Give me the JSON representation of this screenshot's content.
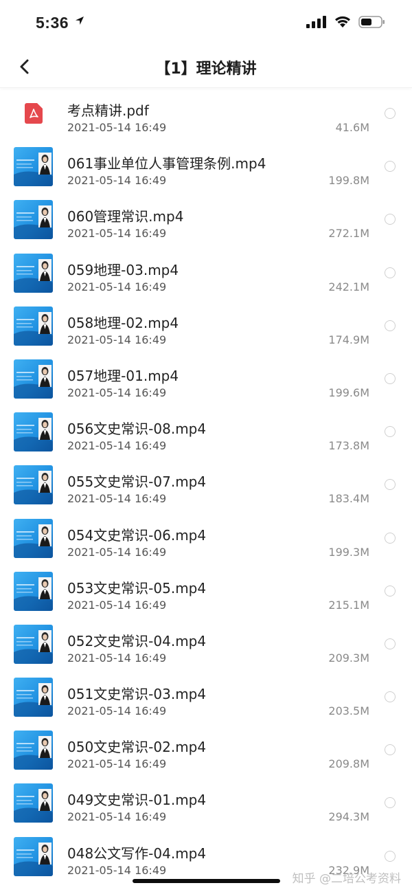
{
  "status_bar": {
    "time": "5:36"
  },
  "nav": {
    "title": "【1】理论精讲"
  },
  "files": [
    {
      "name": "考点精讲.pdf",
      "date": "2021-05-14 16:49",
      "size": "41.6M",
      "type": "pdf"
    },
    {
      "name": "061事业单位人事管理条例.mp4",
      "date": "2021-05-14 16:49",
      "size": "199.8M",
      "type": "video"
    },
    {
      "name": "060管理常识.mp4",
      "date": "2021-05-14 16:49",
      "size": "272.1M",
      "type": "video"
    },
    {
      "name": "059地理-03.mp4",
      "date": "2021-05-14 16:49",
      "size": "242.1M",
      "type": "video"
    },
    {
      "name": "058地理-02.mp4",
      "date": "2021-05-14 16:49",
      "size": "174.9M",
      "type": "video"
    },
    {
      "name": "057地理-01.mp4",
      "date": "2021-05-14 16:49",
      "size": "199.6M",
      "type": "video"
    },
    {
      "name": "056文史常识-08.mp4",
      "date": "2021-05-14 16:49",
      "size": "173.8M",
      "type": "video"
    },
    {
      "name": "055文史常识-07.mp4",
      "date": "2021-05-14 16:49",
      "size": "183.4M",
      "type": "video"
    },
    {
      "name": "054文史常识-06.mp4",
      "date": "2021-05-14 16:49",
      "size": "199.3M",
      "type": "video"
    },
    {
      "name": "053文史常识-05.mp4",
      "date": "2021-05-14 16:49",
      "size": "215.1M",
      "type": "video"
    },
    {
      "name": "052文史常识-04.mp4",
      "date": "2021-05-14 16:49",
      "size": "209.3M",
      "type": "video"
    },
    {
      "name": "051文史常识-03.mp4",
      "date": "2021-05-14 16:49",
      "size": "203.5M",
      "type": "video"
    },
    {
      "name": "050文史常识-02.mp4",
      "date": "2021-05-14 16:49",
      "size": "209.8M",
      "type": "video"
    },
    {
      "name": "049文史常识-01.mp4",
      "date": "2021-05-14 16:49",
      "size": "294.3M",
      "type": "video"
    },
    {
      "name": "048公文写作-04.mp4",
      "date": "2021-05-14 16:49",
      "size": "232.9M",
      "type": "video"
    }
  ],
  "watermark": "知乎 @二培公考资料",
  "colors": {
    "pdf_red": "#e5484d",
    "thumb_blue": "#1f8fe0"
  }
}
